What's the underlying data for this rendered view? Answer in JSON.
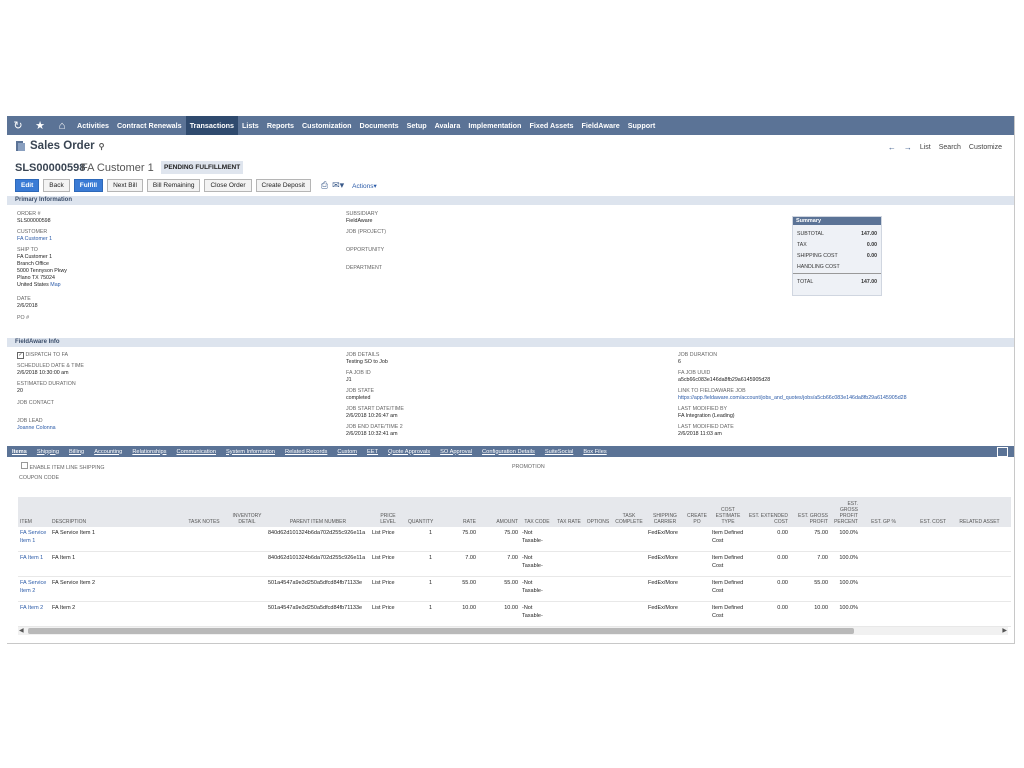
{
  "nav": {
    "items": [
      "Activities",
      "Contract Renewals",
      "Transactions",
      "Lists",
      "Reports",
      "Customization",
      "Documents",
      "Setup",
      "Avalara",
      "Implementation",
      "Fixed Assets",
      "FieldAware",
      "Support"
    ],
    "active_index": 2
  },
  "header": {
    "title": "Sales Order",
    "links": [
      "List",
      "Search",
      "Customize"
    ],
    "record_number": "SLS00000598",
    "record_name": "FA Customer 1",
    "status": "PENDING FULFILLMENT",
    "buttons": [
      "Edit",
      "Back",
      "Fulfill",
      "Next Bill",
      "Bill Remaining",
      "Close Order",
      "Create Deposit"
    ],
    "actions_label": "Actions"
  },
  "primary": {
    "section_title": "Primary Information",
    "order_label": "ORDER #",
    "order_value": "SLS00000598",
    "customer_label": "CUSTOMER",
    "customer_value": "FA Customer 1",
    "ship_to_label": "SHIP TO",
    "ship_to_lines": [
      "FA Customer 1",
      "Branch Office",
      "5000 Tennyson Pkwy",
      "Plano TX 75024",
      "United States"
    ],
    "map_link": "Map",
    "date_label": "DATE",
    "date_value": "2/6/2018",
    "po_label": "PO #",
    "subsidiary_label": "SUBSIDIARY",
    "subsidiary_value": "FieldAware",
    "job_label": "JOB (PROJECT)",
    "opportunity_label": "OPPORTUNITY",
    "department_label": "DEPARTMENT"
  },
  "summary": {
    "title": "Summary",
    "subtotal_label": "SUBTOTAL",
    "subtotal": "147.00",
    "tax_label": "TAX",
    "tax": "0.00",
    "shipping_label": "SHIPPING COST",
    "shipping": "0.00",
    "handling_label": "HANDLING COST",
    "total_label": "TOTAL",
    "total": "147.00"
  },
  "fa": {
    "section_title": "FieldAware Info",
    "dispatch_label": "DISPATCH TO FA",
    "sched_label": "SCHEDULED DATE & TIME",
    "sched_value": "2/6/2018 10:30:00 am",
    "est_dur_label": "ESTIMATED DURATION",
    "est_dur_value": "20",
    "contact_label": "JOB CONTACT",
    "lead_label": "JOB LEAD",
    "lead_value": "Joanne Colonna",
    "details_label": "JOB DETAILS",
    "details_value": "Testing SO to Job",
    "jobid_label": "FA JOB ID",
    "jobid_value": "J1",
    "state_label": "JOB STATE",
    "state_value": "completed",
    "start_label": "JOB START DATE/TIME",
    "start_value": "2/6/2018 10:26:47 am",
    "end_label": "JOB END DATE/TIME 2",
    "end_value": "2/6/2018 10:32:41 am",
    "duration_label": "JOB DURATION",
    "duration_value": "6",
    "uuid_label": "FA JOB UUID",
    "uuid_value": "a5cb66c083e146da8fb29a6145905d28",
    "link_label": "LINK TO FIELDAWARE JOB",
    "link_value": "https://app.fieldaware.com/account/jobs_and_quotes/jobs/a5cb66c083e146da8fb29a6145905d28",
    "modby_label": "LAST MODIFIED BY",
    "modby_value": "FA Integration (Leading)",
    "moddate_label": "LAST MODIFIED DATE",
    "moddate_value": "2/6/2018 11:03 am"
  },
  "subtabs": [
    "Items",
    "Shipping",
    "Billing",
    "Accounting",
    "Relationships",
    "Communication",
    "System Information",
    "Related Records",
    "Custom",
    "EET",
    "Quote Approvals",
    "SO Approval",
    "Configuration Details",
    "SuiteSocial",
    "Box Files"
  ],
  "items_tab": {
    "enable_shipping_label": "ENABLE ITEM LINE SHIPPING",
    "coupon_label": "COUPON CODE",
    "promotion_label": "PROMOTION"
  },
  "table": {
    "columns": [
      "ITEM",
      "DESCRIPTION",
      "TASK NOTES",
      "INVENTORY DETAIL",
      "PARENT ITEM NUMBER",
      "PRICE LEVEL",
      "QUANTITY",
      "RATE",
      "AMOUNT",
      "TAX CODE",
      "TAX RATE",
      "OPTIONS",
      "TASK COMPLETE",
      "SHIPPING CARRIER",
      "CREATE PO",
      "COST ESTIMATE TYPE",
      "EST. EXTENDED COST",
      "EST. GROSS PROFIT",
      "EST. GROSS PROFIT PERCENT",
      "EST. GP %",
      "EST. COST",
      "RELATED ASSET"
    ],
    "rows": [
      [
        "FA Service Item 1",
        "FA Service Item 1",
        "",
        "",
        "840d62d101324b6da702d255c926e11a",
        "List Price",
        "1",
        "75.00",
        "75.00",
        "-Not Taxable-",
        "",
        "",
        "",
        "FedEx/More",
        "",
        "Item Defined Cost",
        "0.00",
        "75.00",
        "100.0%",
        "",
        "",
        ""
      ],
      [
        "FA Item 1",
        "FA Item 1",
        "",
        "",
        "840d62d101324b6da702d255c926e11a",
        "List Price",
        "1",
        "7.00",
        "7.00",
        "-Not Taxable-",
        "",
        "",
        "",
        "FedEx/More",
        "",
        "Item Defined Cost",
        "0.00",
        "7.00",
        "100.0%",
        "",
        "",
        ""
      ],
      [
        "FA Service Item 2",
        "FA Service Item 2",
        "",
        "",
        "501a4547a9e3d250a5dfcd84fb71133e",
        "List Price",
        "1",
        "55.00",
        "55.00",
        "-Not Taxable-",
        "",
        "",
        "",
        "FedEx/More",
        "",
        "Item Defined Cost",
        "0.00",
        "55.00",
        "100.0%",
        "",
        "",
        ""
      ],
      [
        "FA Item 2",
        "FA Item 2",
        "",
        "",
        "501a4547a9e3d250a5dfcd84fb71133e",
        "List Price",
        "1",
        "10.00",
        "10.00",
        "-Not Taxable-",
        "",
        "",
        "",
        "FedEx/More",
        "",
        "Item Defined Cost",
        "0.00",
        "10.00",
        "100.0%",
        "",
        "",
        ""
      ]
    ]
  }
}
